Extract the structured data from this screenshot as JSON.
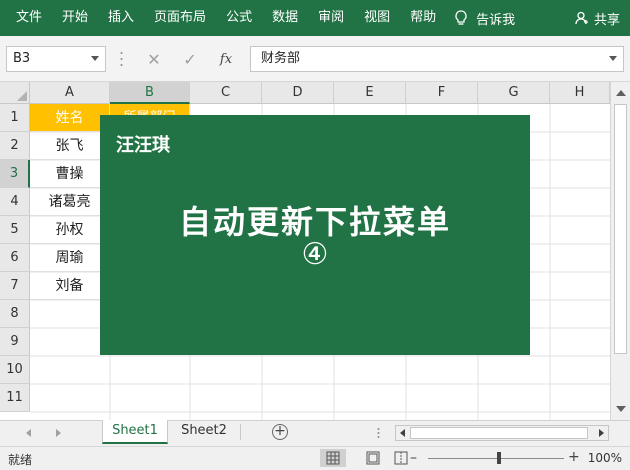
{
  "ribbon": {
    "tabs": [
      "文件",
      "开始",
      "插入",
      "页面布局",
      "公式",
      "数据",
      "审阅",
      "视图",
      "帮助"
    ],
    "tell_me": "告诉我",
    "share": "共享"
  },
  "formula_bar": {
    "name_box": "B3",
    "content": "财务部",
    "fx": "fx"
  },
  "columns": [
    "A",
    "B",
    "C",
    "D",
    "E",
    "F",
    "G",
    "H"
  ],
  "rows": [
    "1",
    "2",
    "3",
    "4",
    "5",
    "6",
    "7",
    "8",
    "9",
    "10",
    "11"
  ],
  "cells": {
    "A1": "姓名",
    "B1": "所属部门",
    "A2": "张飞",
    "A3": "曹操",
    "A4": "诸葛亮",
    "A5": "孙权",
    "A6": "周瑜",
    "A7": "刘备"
  },
  "overlay": {
    "brand": "汪汪琪",
    "title": "自动更新下拉菜单",
    "number": "④"
  },
  "sheets": {
    "active": "Sheet1",
    "other": "Sheet2"
  },
  "status": {
    "ready": "就绪",
    "zoom": "100%"
  },
  "colors": {
    "excel_green": "#217346",
    "header_fill": "#ffc000"
  }
}
